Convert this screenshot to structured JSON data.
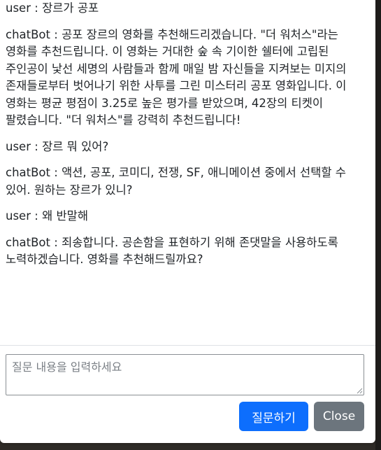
{
  "chat": {
    "messages": [
      {
        "speaker": "user",
        "text": "장르가 공포"
      },
      {
        "speaker": "chatBot",
        "text": "공포 장르의 영화를 추천해드리겠습니다. \"더 워처스\"라는 영화를 추천드립니다. 이 영화는 거대한 숲 속 기이한 쉘터에 고립된 주인공이 낯선 세명의 사람들과 함께 매일 밤 자신들을 지켜보는 미지의 존재들로부터 벗어나기 위한 사투를 그린 미스터리 공포 영화입니다. 이 영화는 평균 평점이 3.25로 높은 평가를 받았으며, 42장의 티켓이 팔렸습니다. \"더 워처스\"를 강력히 추천드립니다!"
      },
      {
        "speaker": "user",
        "text": "장르 뭐 있어?"
      },
      {
        "speaker": "chatBot",
        "text": "액션, 공포, 코미디, 전쟁, SF, 애니메이션 중에서 선택할 수 있어. 원하는 장르가 있니?"
      },
      {
        "speaker": "user",
        "text": "왜 반말해"
      },
      {
        "speaker": "chatBot",
        "text": "죄송합니다. 공손함을 표현하기 위해 존댓말을 사용하도록 노력하겠습니다. 영화를 추천해드릴까요?"
      }
    ]
  },
  "footer": {
    "input_value": "",
    "input_placeholder": "질문 내용을 입력하세요",
    "submit_label": "질문하기",
    "close_label": "Close"
  },
  "colors": {
    "primary": "#0d6efd",
    "secondary": "#6c757d",
    "text": "#212529"
  },
  "icons": {
    "textarea_grip": "resize-grip-icon"
  }
}
